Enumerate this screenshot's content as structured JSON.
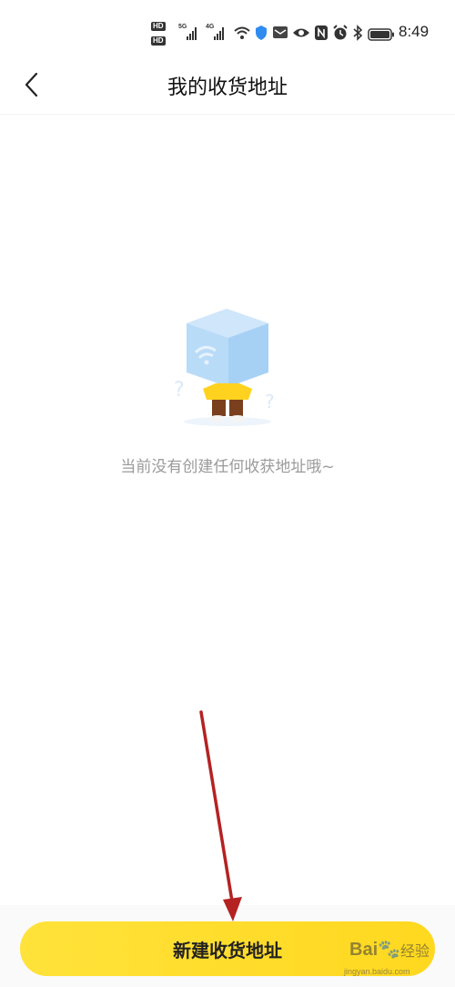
{
  "status_bar": {
    "hd1": "HD",
    "hd2": "HD",
    "net1": "5G",
    "net2": "4G",
    "time": "8:49",
    "icons": [
      "wifi-icon",
      "shield-icon",
      "message-icon",
      "eye-icon",
      "nfc-icon",
      "alarm-icon",
      "bluetooth-icon",
      "battery-icon"
    ]
  },
  "header": {
    "title": "我的收货地址",
    "back_icon": "chevron-left-icon"
  },
  "empty_state": {
    "illustration": "box-mascot-illustration",
    "message": "当前没有创建任何收获地址哦~"
  },
  "footer": {
    "new_address_label": "新建收货地址"
  },
  "watermark": {
    "logo": "Bai🐾",
    "brand": "经验",
    "url": "jingyan.baidu.com"
  },
  "colors": {
    "accent": "#FFDD2B",
    "annotation": "#B42222",
    "muted_text": "#9A9A9A"
  }
}
